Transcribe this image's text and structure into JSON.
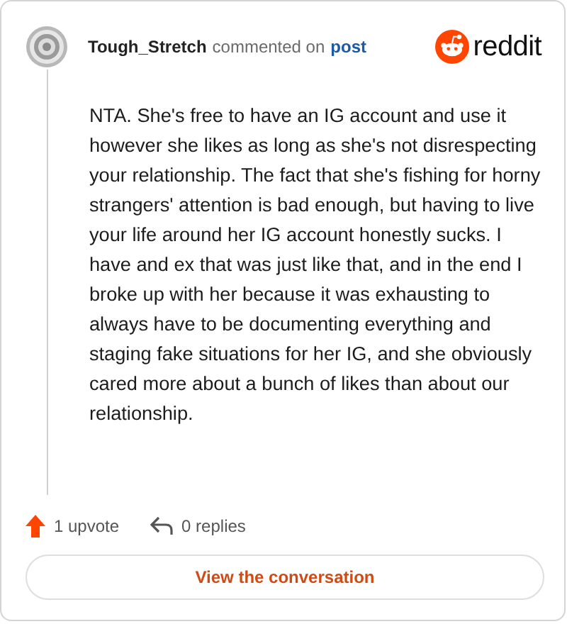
{
  "comment": {
    "author": "Tough_Stretch",
    "action": "commented on",
    "target": "post",
    "brand": "reddit",
    "body": "NTA. She's free to have an IG account and use it however she likes as long as she's not disrespecting your relationship. The fact that she's fishing for horny strangers' attention is bad enough, but having to live your life around her IG account honestly sucks. I have and ex that was just like that, and in the end I broke up with her because it was exhausting to always have to be documenting everything and staging fake situations for her IG, and she obviously cared more about a bunch of likes than about our relationship.",
    "upvotes": "1 upvote",
    "replies": "0 replies"
  },
  "button": "View the conversation"
}
